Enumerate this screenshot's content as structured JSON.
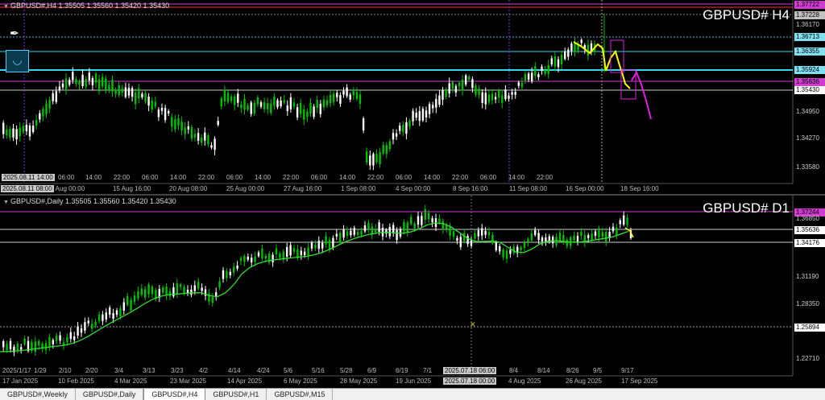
{
  "h4": {
    "header": "GBPUSD#,H4  1.35505 1.35560 1.35420 1.35430",
    "symbol": "GBPUSD# H4",
    "price_labels": [
      {
        "text": "1.37722",
        "color": "#d13bd1"
      },
      {
        "text": "1.37228",
        "color": "#c0c0c0"
      },
      {
        "text": "1.36713",
        "color": "#7fe0f0"
      },
      {
        "text": "1.36355",
        "color": "#7fe0f0"
      },
      {
        "text": "1.35924",
        "color": "#7fe0f0"
      },
      {
        "text": "1.35636",
        "color": "#d13bd1"
      },
      {
        "text": "1.35430",
        "color": "#ffffff"
      }
    ],
    "axis_ticks": [
      "1.36170",
      "1.34950",
      "1.34270",
      "1.33580"
    ],
    "x_labels": [
      "2025.08.11 14:00",
      "06:00",
      "14:00",
      "22:00",
      "06:00",
      "14:00",
      "22:00",
      "06:00",
      "14:00",
      "22:00",
      "06:00",
      "14:00",
      "22:00",
      "06:00",
      "14:00",
      "22:00",
      "06:00",
      "14:00",
      "22:00"
    ],
    "date_labels": [
      "2025.08.11 08:00",
      "13 Aug 00:00",
      "15 Aug 16:00",
      "20 Aug 08:00",
      "25 Aug 00:00",
      "27 Aug 16:00",
      "1 Sep 08:00",
      "4 Sep 00:00",
      "8 Sep 16:00",
      "11 Sep 08:00",
      "16 Sep 00:00",
      "18 Sep 16:00"
    ]
  },
  "d1": {
    "header": "GBPUSD#,Daily  1.35505 1.35560 1.35420 1.35430",
    "symbol": "GBPUSD# D1",
    "price_labels": [
      {
        "text": "1.37244",
        "color": "#d13bd1"
      },
      {
        "text": "1.35636",
        "color": "#ffffff"
      },
      {
        "text": "1.34176",
        "color": "#ffffff"
      },
      {
        "text": "1.25894",
        "color": "#ffffff"
      }
    ],
    "axis_ticks": [
      "1.36850",
      "1.31190",
      "1.28350",
      "1.22710"
    ],
    "x_labels": [
      "2025/1/17",
      "1/29",
      "2/10",
      "2/20",
      "3/4",
      "3/13",
      "3/23",
      "4/2",
      "4/14",
      "4/24",
      "5/6",
      "5/16",
      "5/28",
      "6/9",
      "6/19",
      "7/1",
      "2025.07.18 06:00",
      "8/4",
      "8/14",
      "8/26",
      "9/5",
      "9/17"
    ],
    "date_labels": [
      "17 Jan 2025",
      "10 Feb 2025",
      "4 Mar 2025",
      "23 Mar 2025",
      "14 Apr 2025",
      "6 May 2025",
      "28 May 2025",
      "19 Jun 2025",
      "2025.07.18 00:00",
      "4 Aug 2025",
      "26 Aug 2025",
      "17 Sep 2025"
    ]
  },
  "tabs": [
    "GBPUSD#,Weekly",
    "GBPUSD#,Daily",
    "GBPUSD#,H4",
    "GBPUSD#,H1",
    "GBPUSD#,M15"
  ],
  "active_tab": "GBPUSD#,H4",
  "colors": {
    "bull": "#00c000",
    "bear": "#ffffff",
    "ma": "#33dd33",
    "projection_yellow": "#ffff00",
    "projection_magenta": "#e020e0",
    "cyan_line": "#30d8f0",
    "magenta_line": "#d13bd1"
  },
  "icons": [
    "pen-icon",
    "smile-icon"
  ]
}
